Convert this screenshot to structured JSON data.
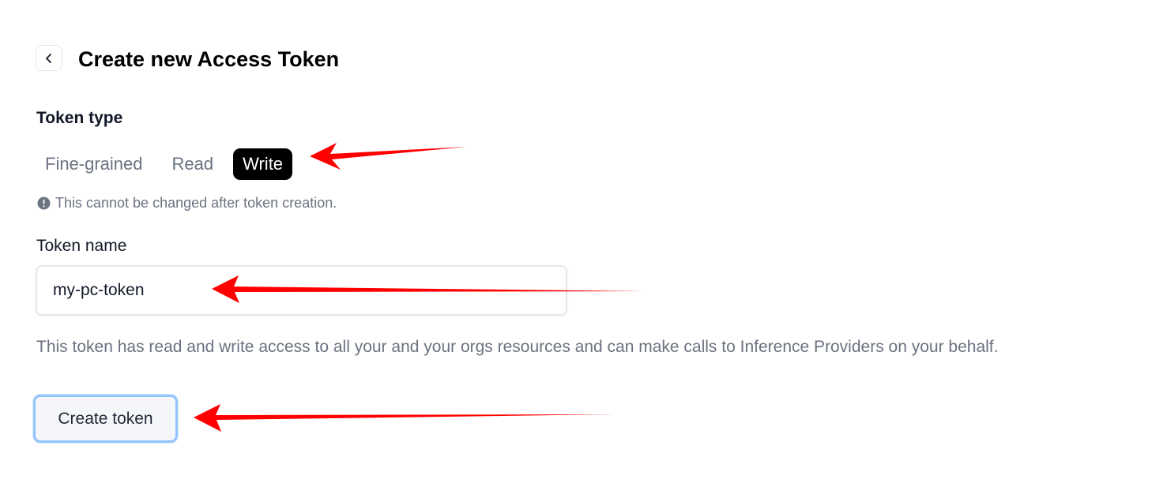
{
  "header": {
    "title": "Create new Access Token",
    "back_icon": "chevron-left-icon"
  },
  "token_type": {
    "label": "Token type",
    "options": [
      {
        "label": "Fine-grained",
        "selected": false
      },
      {
        "label": "Read",
        "selected": false
      },
      {
        "label": "Write",
        "selected": true
      }
    ],
    "notice_icon": "exclamation-circle-icon",
    "notice": "This cannot be changed after token creation."
  },
  "token_name": {
    "label": "Token name",
    "value": "my-pc-token"
  },
  "description": "This token has read and write access to all your and your orgs resources and can make calls to Inference Providers on your behalf.",
  "actions": {
    "create_label": "Create token"
  },
  "colors": {
    "active_tab_bg": "#000000",
    "muted_text": "#6b7280",
    "focus_ring": "#93c5fd",
    "annotation_arrow": "#ff0000"
  }
}
